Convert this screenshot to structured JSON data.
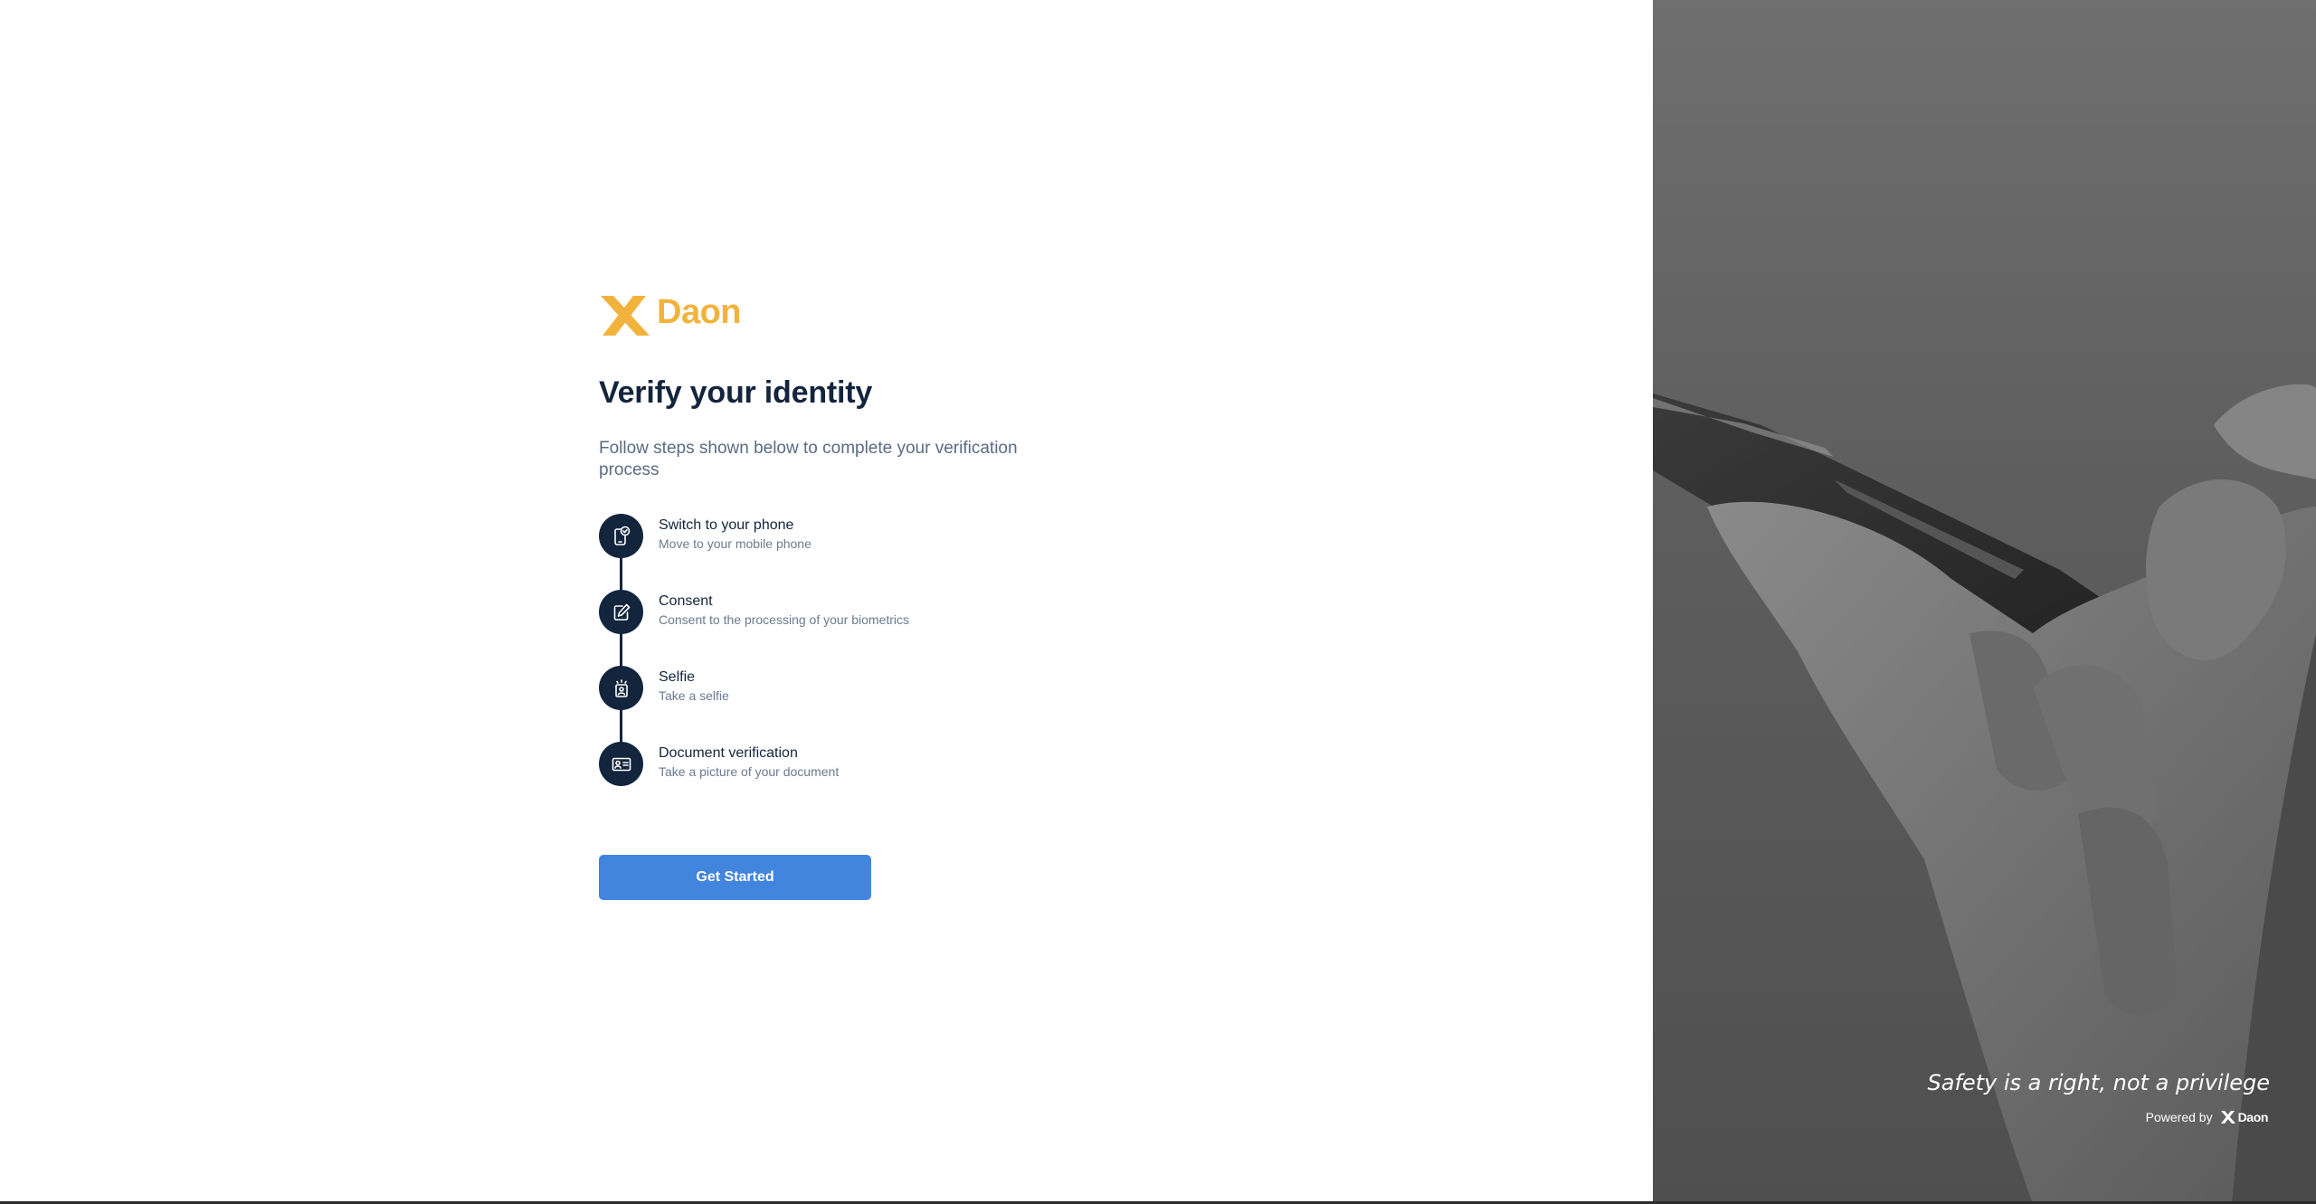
{
  "brand": {
    "name": "Daon",
    "color": "#f2b33d"
  },
  "main": {
    "title": "Verify your identity",
    "subtitle": "Follow steps shown below to complete your verification process",
    "steps": [
      {
        "title": "Switch to your phone",
        "description": "Move to your mobile phone",
        "icon": "phone-check-icon"
      },
      {
        "title": "Consent",
        "description": "Consent to the processing of your biometrics",
        "icon": "pen-edit-icon"
      },
      {
        "title": "Selfie",
        "description": "Take a selfie",
        "icon": "selfie-icon"
      },
      {
        "title": "Document verification",
        "description": "Take a picture of your document",
        "icon": "id-card-icon"
      }
    ],
    "cta_label": "Get Started",
    "cta_color": "#4285de"
  },
  "side_panel": {
    "tagline": "Safety is a right, not a privilege",
    "powered_by": "Powered by",
    "powered_brand": "Daon"
  },
  "colors": {
    "navy": "#13243d",
    "muted": "#5a6b85"
  }
}
